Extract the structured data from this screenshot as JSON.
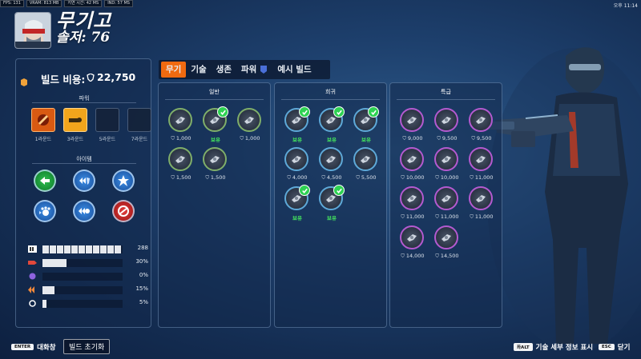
{
  "hud": {
    "fps": "FPS: 131",
    "vram": "VRAM: 813 MB",
    "latency": "지연 시간: 42 MS",
    "ind": "IND: 57 MS"
  },
  "clock": "오후 11:14",
  "hero": {
    "title": "무기고",
    "name": "솔저: 76"
  },
  "build": {
    "cost_label": "빌드 비용:",
    "cost_value": "22,750"
  },
  "tabs": [
    "무기",
    "기술",
    "생존",
    "파워",
    "예시 빌드"
  ],
  "powers": {
    "title": "파워",
    "slots": [
      {
        "label": "1라운드",
        "filled": true,
        "icon": "power-icon-1"
      },
      {
        "label": "3라운드",
        "filled": true,
        "icon": "power-icon-2"
      },
      {
        "label": "5라운드",
        "filled": false
      },
      {
        "label": "7라운드",
        "filled": false
      }
    ]
  },
  "items_panel": {
    "title": "아이템",
    "items": [
      {
        "name": "green-arrows-item-icon",
        "color": "#1f9b3d"
      },
      {
        "name": "shield-arrows-item-icon",
        "color": "#2f7ed8"
      },
      {
        "name": "burst-item-icon",
        "color": "#2f7ed8"
      },
      {
        "name": "paw-item-icon",
        "color": "#2f7ed8"
      },
      {
        "name": "double-arrow-item-icon",
        "color": "#2f7ed8"
      },
      {
        "name": "no-sign-item-icon",
        "color": "#d82a2a"
      }
    ]
  },
  "stats": [
    {
      "icon": "ammo-icon",
      "value": "288",
      "segments": 11
    },
    {
      "icon": "weapon-power-icon",
      "value": "30%",
      "fill": 0.3
    },
    {
      "icon": "ability-power-icon",
      "value": "0%",
      "fill": 0
    },
    {
      "icon": "attack-speed-icon",
      "value": "15%",
      "fill": 0.15
    },
    {
      "icon": "reload-speed-icon",
      "value": "5%",
      "fill": 0.05
    }
  ],
  "tiers": [
    {
      "title": "일반",
      "items": [
        {
          "icon": "reload-icon",
          "price": "1,000",
          "owned": false
        },
        {
          "icon": "target-icon",
          "price": "보유",
          "owned": true
        },
        {
          "icon": "gun-icon",
          "price": "1,000",
          "owned": false
        },
        {
          "icon": "skull-icon",
          "price": "1,500",
          "owned": false
        },
        {
          "icon": "ammo-box-icon",
          "price": "1,500",
          "owned": false
        }
      ]
    },
    {
      "title": "희귀",
      "items": [
        {
          "icon": "scope-icon",
          "price": "보유",
          "owned": true
        },
        {
          "icon": "bullet-icon",
          "price": "보유",
          "owned": true
        },
        {
          "icon": "rifle-icon",
          "price": "보유",
          "owned": true
        },
        {
          "icon": "magazine-icon",
          "price": "4,000",
          "owned": false
        },
        {
          "icon": "burst-shot-icon",
          "price": "4,500",
          "owned": false
        },
        {
          "icon": "pistol-icon",
          "price": "5,500",
          "owned": false
        },
        {
          "icon": "crosshair-icon",
          "price": "보유",
          "owned": true
        },
        {
          "icon": "clock-icon",
          "price": "보유",
          "owned": true
        }
      ]
    },
    {
      "title": "특급",
      "items": [
        {
          "icon": "sword-icon",
          "price": "9,000",
          "owned": false
        },
        {
          "icon": "turret-icon",
          "price": "9,500",
          "owned": false
        },
        {
          "icon": "grenade-icon",
          "price": "9,500",
          "owned": false
        },
        {
          "icon": "rocket-icon",
          "price": "10,000",
          "owned": false
        },
        {
          "icon": "stack-icon",
          "price": "10,000",
          "owned": false
        },
        {
          "icon": "wings-icon",
          "price": "11,000",
          "owned": false
        },
        {
          "icon": "split-icon",
          "price": "11,000",
          "owned": false
        },
        {
          "icon": "cannon-icon",
          "price": "11,000",
          "owned": false
        },
        {
          "icon": "medkit-icon",
          "price": "11,000",
          "owned": false
        },
        {
          "icon": "spike-icon",
          "price": "14,000",
          "owned": false
        },
        {
          "icon": "cross-icon",
          "price": "14,500",
          "owned": false
        }
      ]
    }
  ],
  "footer": {
    "enter_key": "ENTER",
    "chat_label": "대화창",
    "reset_label": "빌드 초기화",
    "alt_key": "좌ALT",
    "skill_detail_label": "기술 세부 정보 표시",
    "esc_key": "ESC",
    "close_label": "닫기"
  },
  "colors": {
    "accent": "#f06a10",
    "owned_green": "#45ea5e",
    "common_border": "#7fae6a",
    "rare_border": "#5ea9d8",
    "epic_border": "#b45ad0"
  }
}
